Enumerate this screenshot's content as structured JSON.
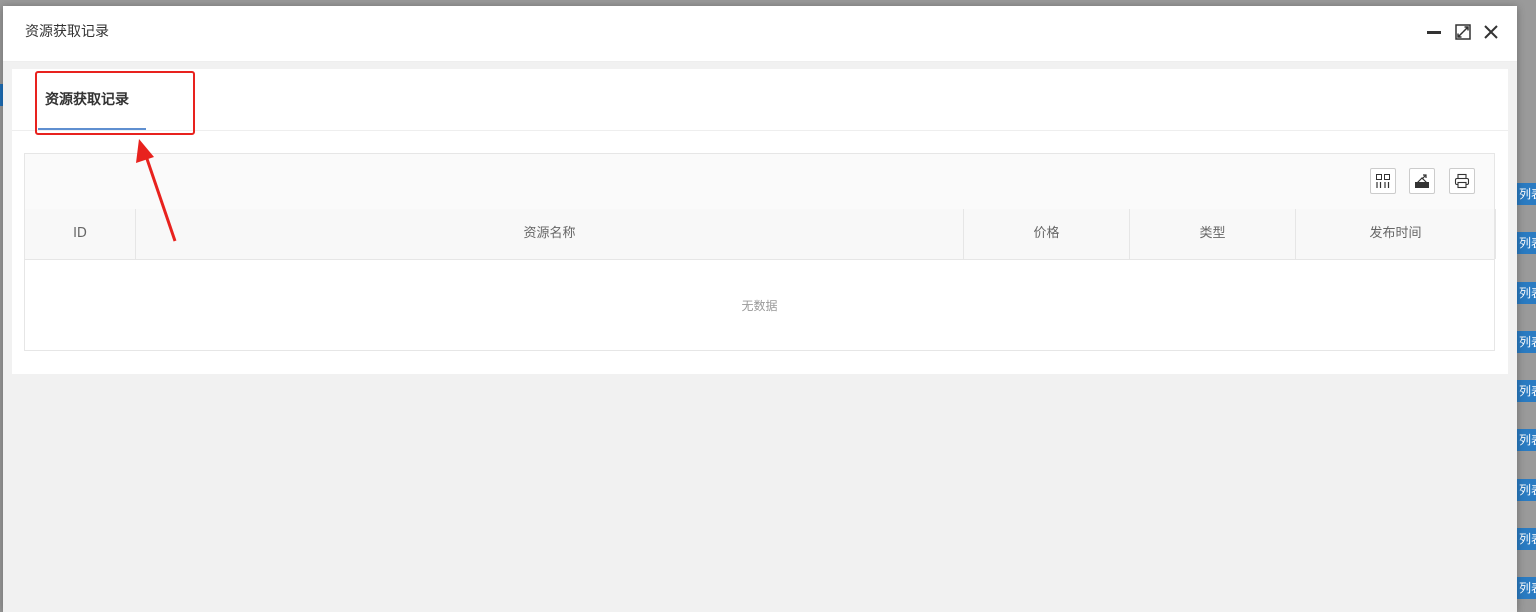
{
  "modal": {
    "title": "资源获取记录"
  },
  "tabs": [
    {
      "label": "资源获取记录",
      "active": true
    }
  ],
  "table": {
    "columns": [
      "ID",
      "资源名称",
      "价格",
      "类型",
      "发布时间"
    ],
    "rows": [],
    "empty_text": "无数据"
  },
  "toolbar": {
    "icons": [
      "columns-icon",
      "export-icon",
      "print-icon"
    ]
  },
  "background": {
    "side_buttons": [
      "列表",
      "列表",
      "列表",
      "列表",
      "列表",
      "列表",
      "列表",
      "列表",
      "列表"
    ]
  },
  "colors": {
    "accent": "#5f8fd0",
    "annotation": "#e8221e",
    "side_button": "#2a7bc2"
  }
}
